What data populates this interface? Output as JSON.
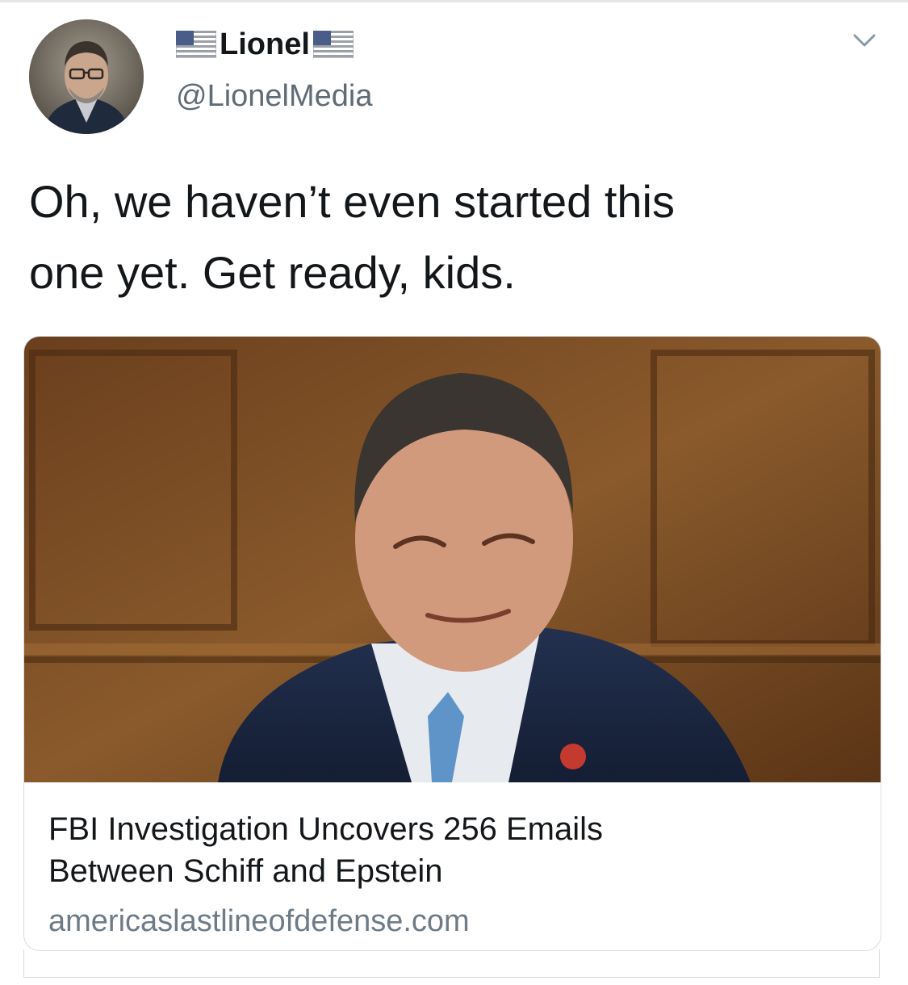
{
  "tweet": {
    "display_name": "Lionel",
    "handle": "@LionelMedia",
    "text_line1": "Oh, we haven’t even started this",
    "text_line2": "one yet. Get ready, kids.",
    "name_flag_icon": "us-flag-icon",
    "menu_icon": "chevron-down-icon"
  },
  "card": {
    "title_line1": "FBI Investigation Uncovers 256 Emails",
    "title_line2": "Between Schiff and Epstein",
    "domain": "americaslastlineofdefense.com"
  },
  "colors": {
    "text": "#14171a",
    "secondary_text": "#5f6b75",
    "border": "#d8dde2",
    "card_background_wood": "#7a4a22"
  }
}
